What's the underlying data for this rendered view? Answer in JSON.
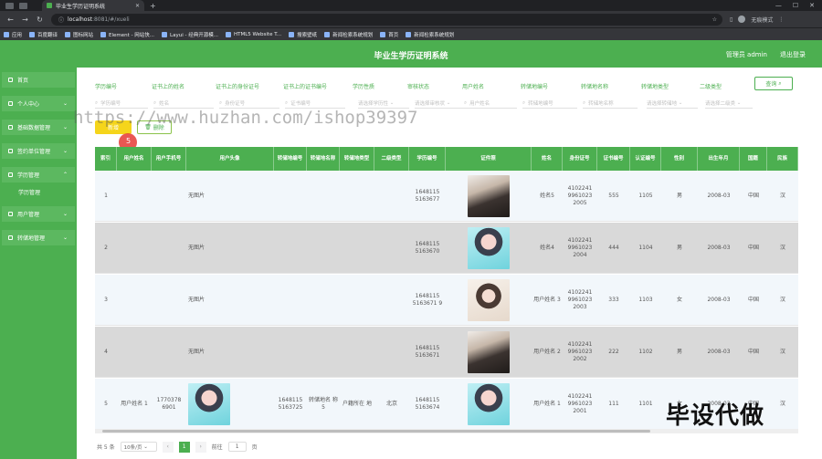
{
  "browser": {
    "tab_title": "毕业生学历证明系统",
    "new_tab": "+",
    "url_host": "localhost",
    "url_path": ":8081/#/xueli",
    "profile": "无痕模式",
    "bookmarks": [
      "应用",
      "百度翻译",
      "图标网站",
      "Element - 网站快...",
      "Layui - 经典开源模...",
      "HTML5 Website T...",
      "搜索壁纸",
      "新闻检索系统规划",
      "首页",
      "新闻检索系统规划"
    ]
  },
  "header": {
    "title": "毕业生学历证明系统",
    "admin": "管理员 admin",
    "logout": "退出登录"
  },
  "sidebar": {
    "items": [
      {
        "label": "首页"
      },
      {
        "label": "个人中心"
      },
      {
        "label": "基础数据管理"
      },
      {
        "label": "签约单位管理"
      },
      {
        "label": "学历管理"
      },
      {
        "label": "用户管理"
      },
      {
        "label": "转储地管理"
      }
    ],
    "sub_item": "学历管理"
  },
  "filters": {
    "labels": [
      "学历编号",
      "证书上的姓名",
      "证书上的身份证号",
      "证书上的证书编号",
      "学历性质",
      "审核状态",
      "用户姓名",
      "转储地编号",
      "转储地名称",
      "转储地类型",
      "二级类型"
    ],
    "placeholders": [
      "学历编号",
      "姓名",
      "身份证号",
      "证书编号",
      "请选择学历性",
      "请选择审核状",
      "用户姓名",
      "转储地编号",
      "转储地名称",
      "请选择转储地",
      "请选择二级类"
    ],
    "query_button": "查询"
  },
  "actions": {
    "add": "新增",
    "delete": "删除"
  },
  "table": {
    "columns": [
      "索引",
      "用户姓名",
      "用户手机号",
      "用户头像",
      "转储地编号",
      "转储地名称",
      "转储地类型",
      "二级类型",
      "学历编号",
      "证件照",
      "姓名",
      "身份证号",
      "证书编号",
      "认证编号",
      "性别",
      "出生年月",
      "国籍",
      "民族"
    ],
    "rows": [
      {
        "index": "1",
        "user_name": "",
        "phone": "",
        "avatar": "无图片",
        "dump_no": "",
        "dump_name": "",
        "dump_type": "",
        "sub_type": "",
        "edu_no": "1648115 5163677",
        "photo": "dark",
        "name": "姓名5",
        "id_no": "4102241 9961023 2005",
        "cert_no": "555",
        "auth_no": "1105",
        "gender": "男",
        "birth": "2008-03",
        "nation": "中国",
        "ethnic": "汉"
      },
      {
        "index": "2",
        "user_name": "",
        "phone": "",
        "avatar": "无图片",
        "dump_no": "",
        "dump_name": "",
        "dump_type": "",
        "sub_type": "",
        "edu_no": "1648115 5163670",
        "photo": "cyan",
        "name": "姓名4",
        "id_no": "4102241 9961023 2004",
        "cert_no": "444",
        "auth_no": "1104",
        "gender": "男",
        "birth": "2008-03",
        "nation": "中国",
        "ethnic": "汉"
      },
      {
        "index": "3",
        "user_name": "",
        "phone": "",
        "avatar": "无图片",
        "dump_no": "",
        "dump_name": "",
        "dump_type": "",
        "sub_type": "",
        "edu_no": "1648115 5163671 9",
        "photo": "light",
        "name": "用户姓名 3",
        "id_no": "4102241 9961023 2003",
        "cert_no": "333",
        "auth_no": "1103",
        "gender": "女",
        "birth": "2008-03",
        "nation": "中国",
        "ethnic": "汉"
      },
      {
        "index": "4",
        "user_name": "",
        "phone": "",
        "avatar": "无图片",
        "dump_no": "",
        "dump_name": "",
        "dump_type": "",
        "sub_type": "",
        "edu_no": "1648115 5163671",
        "photo": "dark",
        "name": "用户姓名 2",
        "id_no": "4102241 9961023 2002",
        "cert_no": "222",
        "auth_no": "1102",
        "gender": "男",
        "birth": "2008-03",
        "nation": "中国",
        "ethnic": "汉"
      },
      {
        "index": "5",
        "user_name": "用户姓名 1",
        "phone": "1770378 6901",
        "avatar": "",
        "dump_no": "1648115 5163725",
        "dump_name": "转储地名 称5",
        "dump_type": "户籍所在 地",
        "sub_type": "北京",
        "edu_no": "1648115 5163674",
        "photo": "cyan",
        "name": "用户姓名 1",
        "id_no": "4102241 9961023 2001",
        "cert_no": "111",
        "auth_no": "1101",
        "gender": "女",
        "birth": "2008-03",
        "nation": "中国",
        "ethnic": "汉"
      }
    ]
  },
  "pager": {
    "total": "共 5 条",
    "page_size": "10条/页",
    "current": "1",
    "goto_label": "前往",
    "goto_value": "1",
    "page_suffix": "页"
  },
  "overlay": {
    "watermark": "https://www.huzhan.com/ishop39397",
    "stamp": "毕设代做",
    "cursor_num": "5"
  },
  "colors": {
    "primary": "#4caf50",
    "add_button": "#f5d51b"
  }
}
